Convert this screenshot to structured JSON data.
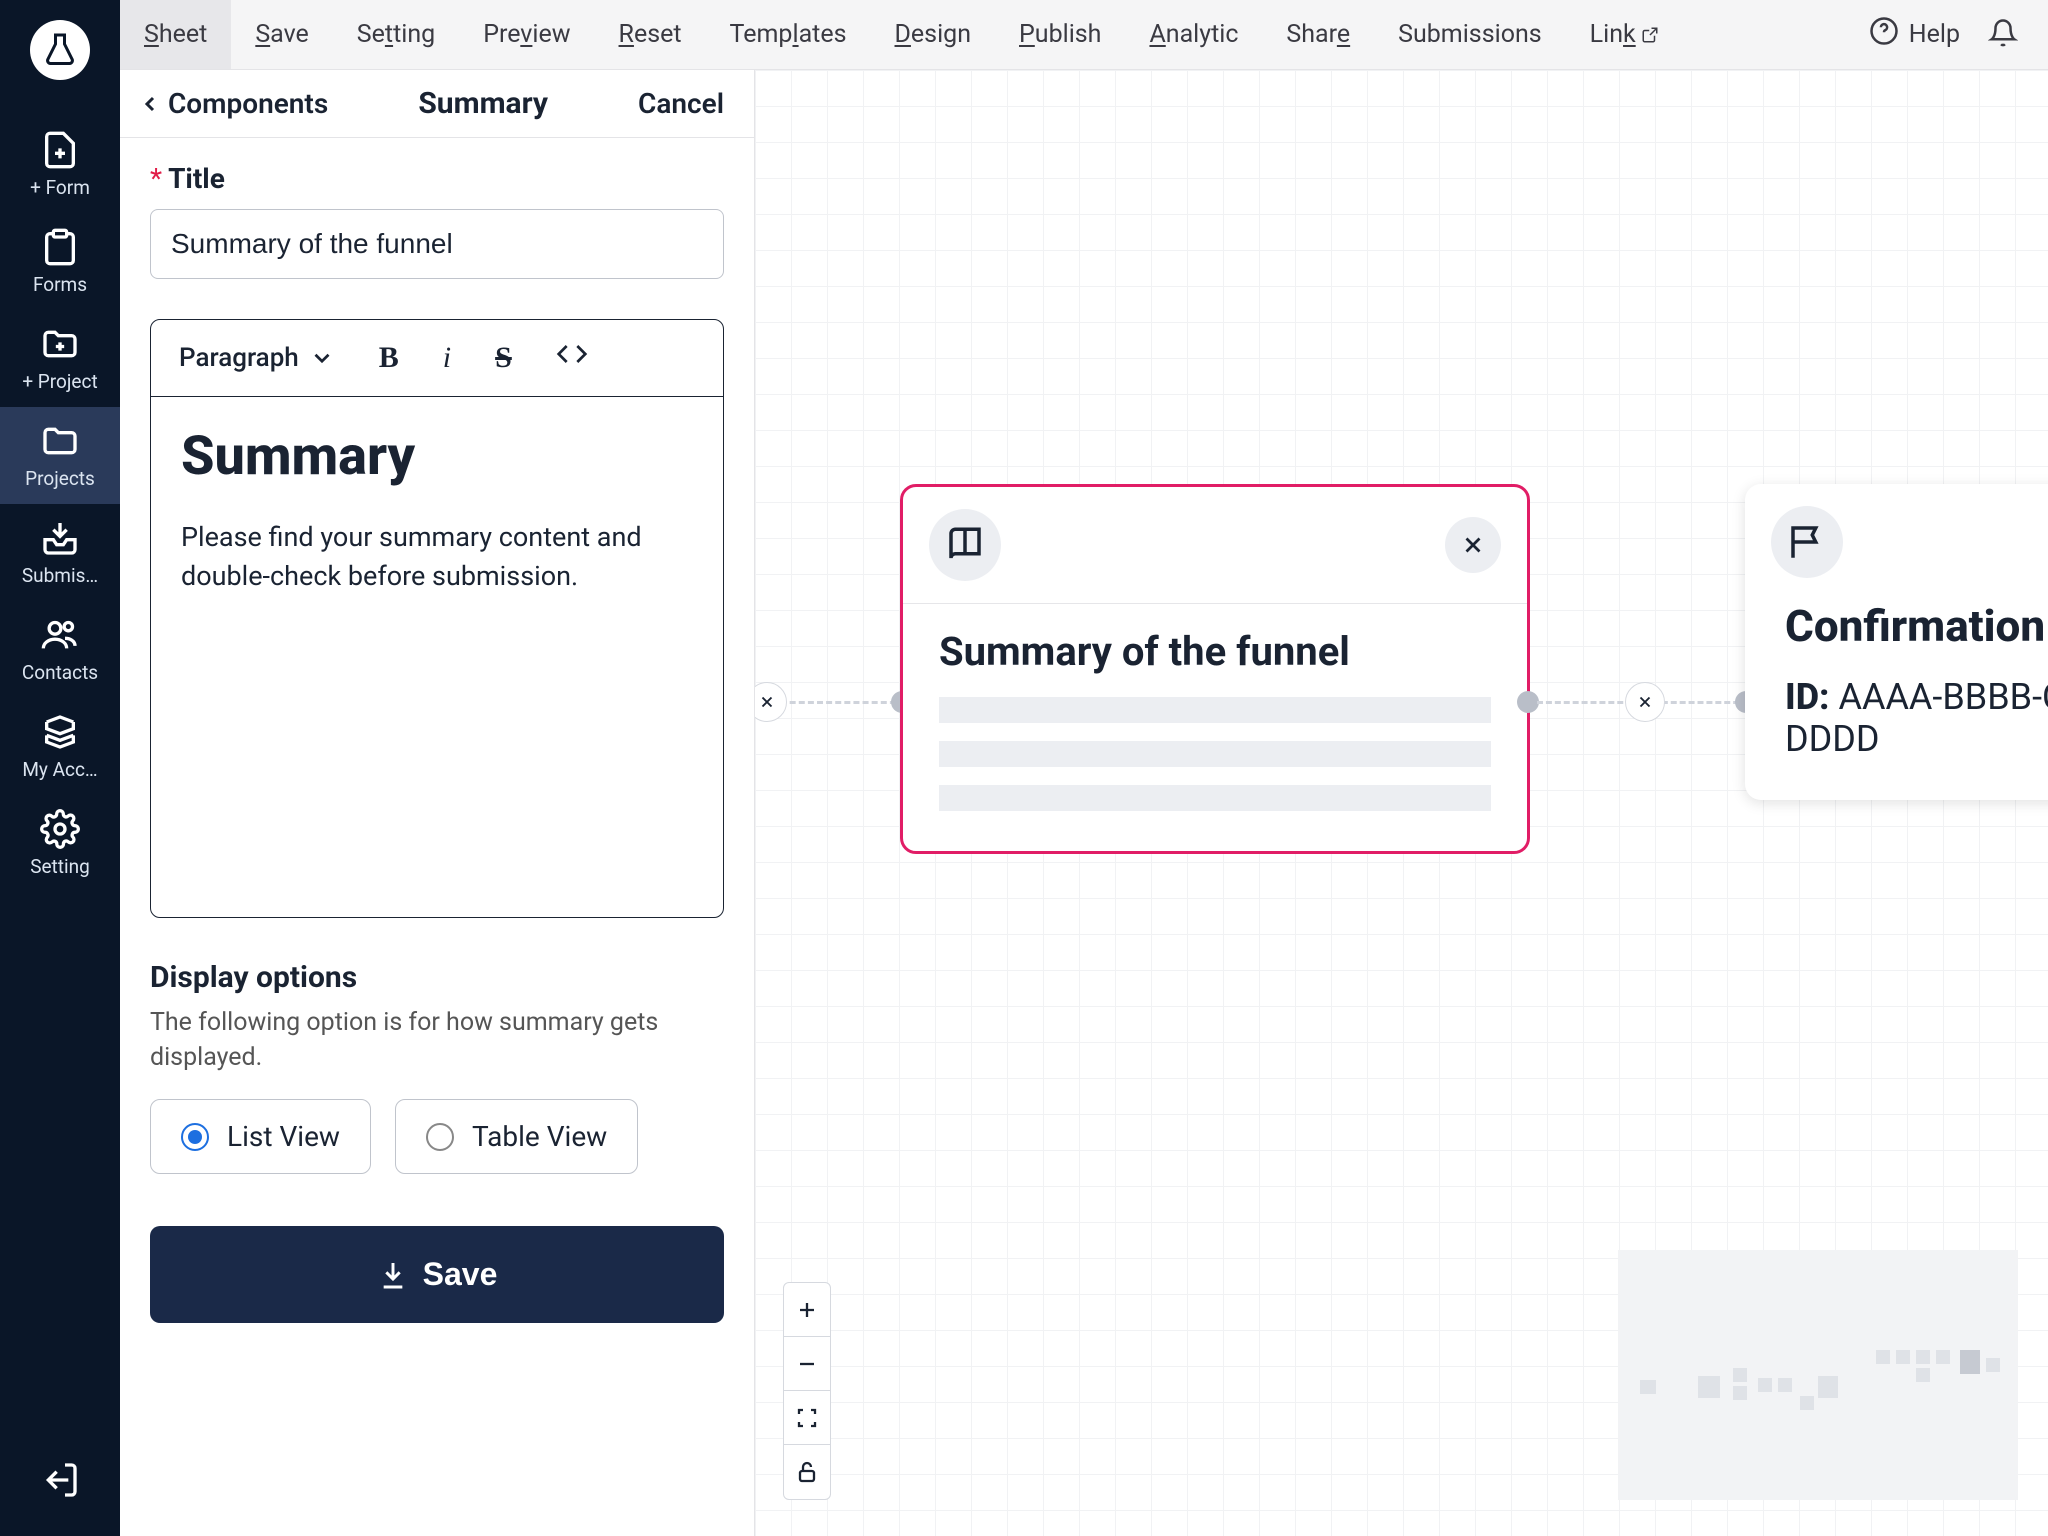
{
  "topbar": {
    "items": [
      "Sheet",
      "Save",
      "Setting",
      "Preview",
      "Reset",
      "Templates",
      "Design",
      "Publish",
      "Analytic",
      "Share",
      "Submissions",
      "Link"
    ],
    "help": "Help"
  },
  "vnav": {
    "items": [
      {
        "label": "+ Form"
      },
      {
        "label": "Forms"
      },
      {
        "label": "+ Project"
      },
      {
        "label": "Projects"
      },
      {
        "label": "Submis…"
      },
      {
        "label": "Contacts"
      },
      {
        "label": "My Acc…"
      },
      {
        "label": "Setting"
      }
    ]
  },
  "panel": {
    "back": "Components",
    "title": "Summary",
    "cancel": "Cancel",
    "field_title_label": "Title",
    "field_title_value": "Summary of the funnel",
    "editor": {
      "style_dropdown": "Paragraph",
      "heading": "Summary",
      "body": "Please find your summary content and double-check before submission."
    },
    "display": {
      "title": "Display options",
      "desc": "The following option is for how summary gets displayed.",
      "opt1": "List View",
      "opt2": "Table View"
    },
    "save": "Save"
  },
  "canvas": {
    "node1_title": "Summary of the funnel",
    "node2_title": "Confirmation",
    "node2_id_label": "ID:",
    "node2_id_value": "AAAA-BBBB-CCCC-DDDD"
  }
}
